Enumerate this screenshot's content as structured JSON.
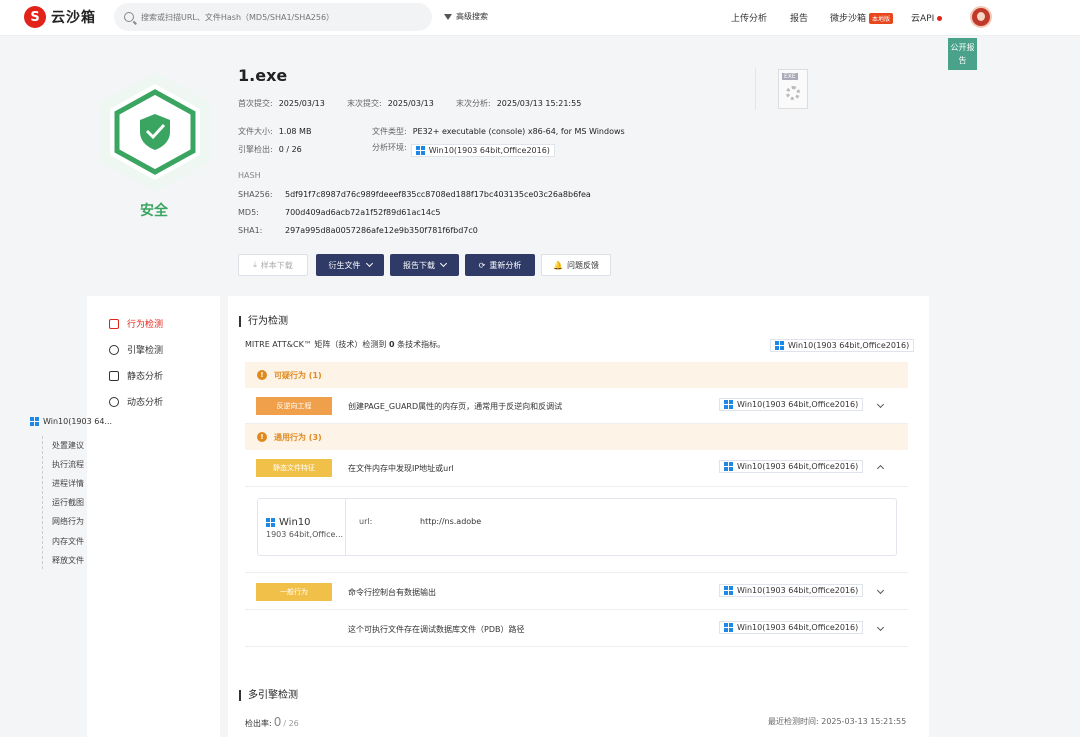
{
  "nav": {
    "logo_mark": "S",
    "logo_text": "云沙箱",
    "search_placeholder": "搜索或扫描URL、文件Hash（MD5/SHA1/SHA256）",
    "advanced_search": "高级搜索",
    "upload": "上传分析",
    "report": "报告",
    "micro_sandbox": "微步沙箱",
    "micro_badge": "本地版",
    "api": "云API",
    "public_tag": "公开报告"
  },
  "summary": {
    "verdict": "安全",
    "file_name": "1.exe",
    "first_submit_label": "首次提交:",
    "first_submit": "2025/03/13",
    "last_submit_label": "末次提交:",
    "last_submit": "2025/03/13",
    "last_analysis_label": "末次分析:",
    "last_analysis": "2025/03/13 15:21:55",
    "file_size_label": "文件大小:",
    "file_size": "1.08 MB",
    "file_type_label": "文件类型:",
    "file_type": "PE32+ executable (console) x86-64, for MS Windows",
    "engine_label": "引擎检出:",
    "engine": "0 / 26",
    "env_label": "分析环境:",
    "env": "Win10(1903 64bit,Office2016)",
    "hash_title": "HASH",
    "sha256_label": "SHA256:",
    "sha256": "5df91f7c8987d76c989fdeeef835cc8708ed188f17bc403135ce03c26a8b6fea",
    "md5_label": "MD5:",
    "md5": "700d409ad6acb72a1f52f89d61ac14c5",
    "sha1_label": "SHA1:",
    "sha1": "297a995d8a0057286afe12e9b350f781f6fbd7c0",
    "exe_tag": "EXE"
  },
  "actions": {
    "download_sample": "样本下载",
    "derived_files": "衍生文件",
    "report_download": "报告下载",
    "reanalyze": "重新分析",
    "feedback": "问题反馈"
  },
  "sidebar": {
    "items": [
      {
        "label": "行为检测"
      },
      {
        "label": "引擎检测"
      },
      {
        "label": "静态分析"
      },
      {
        "label": "动态分析"
      }
    ],
    "env_node": "Win10(1903 64...",
    "leaves": [
      "处置建议",
      "执行流程",
      "进程详情",
      "运行截图",
      "网络行为",
      "内存文件",
      "释放文件"
    ]
  },
  "behavior": {
    "title": "行为检测",
    "mitre_prefix": "MITRE ATT&CK™ 矩阵（技术）检测到",
    "mitre_count": "0",
    "mitre_suffix": "条技术指标。",
    "env": "Win10(1903 64bit,Office2016)",
    "suspicious_group": "可疑行为 (1)",
    "general_group": "通用行为 (3)",
    "rows": [
      {
        "tag": "反逆向工程",
        "text": "创建PAGE_GUARD属性的内存页，通常用于反逆向和反调试",
        "env": "Win10(1903 64bit,Office2016)"
      },
      {
        "tag": "静态文件特征",
        "text": "在文件内存中发现IP地址或url",
        "env": "Win10(1903 64bit,Office2016)"
      },
      {
        "tag": "一般行为",
        "text": "命令行控制台有数据输出",
        "env": "Win10(1903 64bit,Office2016)"
      },
      {
        "tag": "",
        "text": "这个可执行文件存在调试数据库文件（PDB）路径",
        "env": "Win10(1903 64bit,Office2016)"
      }
    ],
    "detail": {
      "os": "Win10",
      "os_sub": "1903 64bit,Office...",
      "key": "url:",
      "value": "http://ns.adobe"
    }
  },
  "multi_engine": {
    "title": "多引擎检测",
    "rate_label": "检出率:",
    "detected": "0",
    "total": "/ 26",
    "last_time_label": "最近检测时间:",
    "last_time": "2025-03-13 15:21:55"
  }
}
